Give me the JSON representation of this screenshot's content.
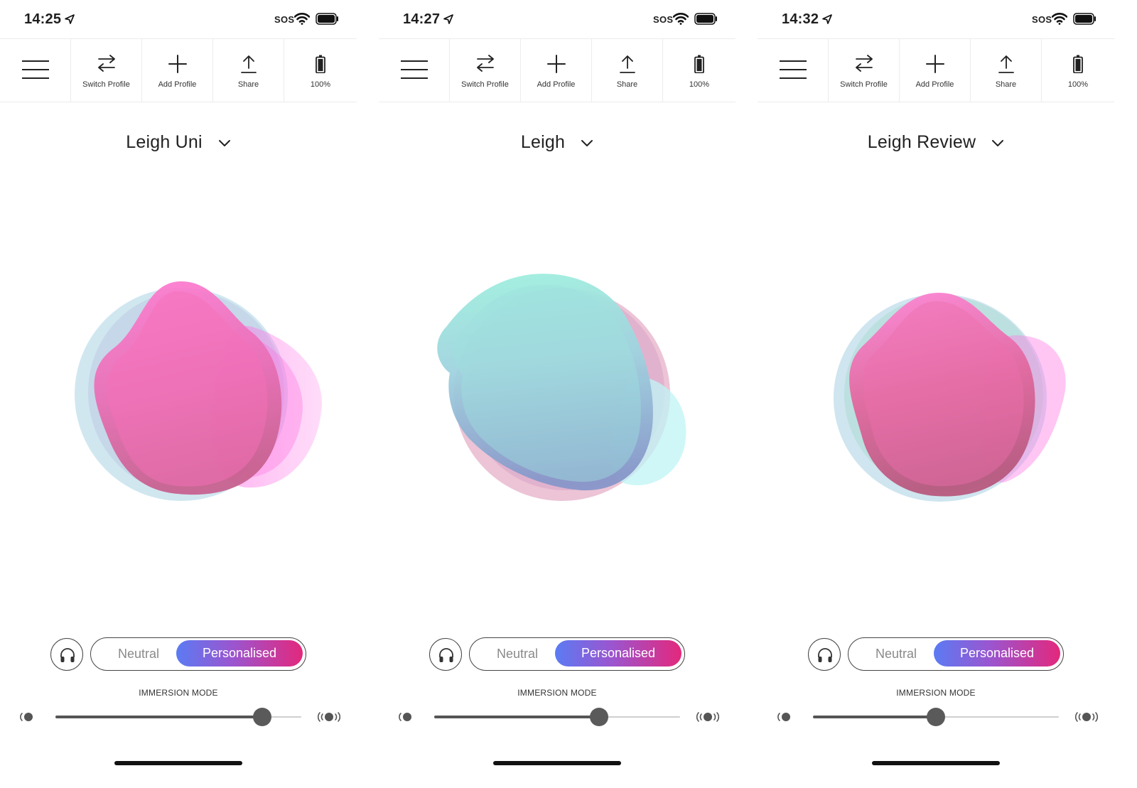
{
  "toolbar": {
    "menu_icon": "hamburger-icon",
    "items": [
      {
        "label": "Switch Profile",
        "icon": "switch-arrows-icon"
      },
      {
        "label": "Add Profile",
        "icon": "plus-icon"
      },
      {
        "label": "Share",
        "icon": "share-upload-icon"
      },
      {
        "label": "100%",
        "icon": "battery-icon"
      }
    ]
  },
  "status_bar": {
    "carrier_text": "SOS"
  },
  "mode": {
    "neutral_label": "Neutral",
    "personalised_label": "Personalised",
    "selected": "Personalised"
  },
  "immersion": {
    "label": "IMMERSION MODE"
  },
  "colors": {
    "pink": "#ff7ad0",
    "teal": "#8fe9df",
    "blue": "#94b8dc",
    "gradient_start": "#5b7bf3",
    "gradient_end": "#e3287c"
  },
  "screens": [
    {
      "time": "14:25",
      "profile_name": "Leigh Uni",
      "immersion_level": 0.84,
      "blob_style": "pink"
    },
    {
      "time": "14:27",
      "profile_name": "Leigh",
      "immersion_level": 0.67,
      "blob_style": "teal"
    },
    {
      "time": "14:32",
      "profile_name": "Leigh Review",
      "immersion_level": 0.5,
      "blob_style": "pink2"
    }
  ]
}
